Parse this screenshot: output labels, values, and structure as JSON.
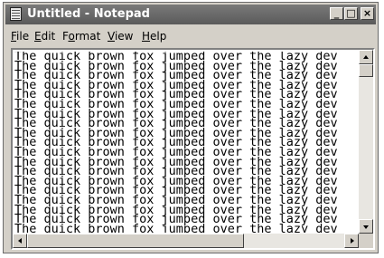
{
  "window": {
    "title": "Untitled - Notepad",
    "buttons": {
      "minimize": "_",
      "maximize": "□",
      "close": "×"
    }
  },
  "menu": [
    {
      "accel": "F",
      "rest": "ile"
    },
    {
      "accel": "E",
      "rest": "dit"
    },
    {
      "pre": "F",
      "accel": "o",
      "rest": "rmat"
    },
    {
      "accel": "V",
      "rest": "iew"
    },
    {
      "accel": "H",
      "rest": "elp"
    }
  ],
  "editor": {
    "lines": [
      "The quick brown fox jumped over the lazy dev",
      "The quick brown fox jumped over the lazy dev",
      "The quick brown fox jumped over the lazy dev",
      "The quick brown fox jumped over the lazy dev",
      "The quick brown fox jumped over the lazy dev",
      "The quick brown fox jumped over the lazy dev",
      "The quick brown fox jumped over the lazy dev",
      "The quick brown fox jumped over the lazy dev",
      "The quick brown fox jumped over the lazy dev",
      "The quick brown fox jumped over the lazy dev",
      "The quick brown fox jumped over the lazy dev",
      "The quick brown fox jumped over the lazy dev",
      "The quick brown fox jumped over the lazy dev",
      "The quick brown fox jumped over the lazy dev",
      "The quick brown fox jumped over the lazy dev",
      "The quick brown fox jumped over the lazy dev",
      "The quick brown fox jumped over the lazy dev",
      "The quick brown fox jumped over the lazy dev",
      "The quick brown fox jumped over the lazy dev"
    ]
  },
  "scrollbars": {
    "vertical_position": 0,
    "horizontal_position": 0
  }
}
